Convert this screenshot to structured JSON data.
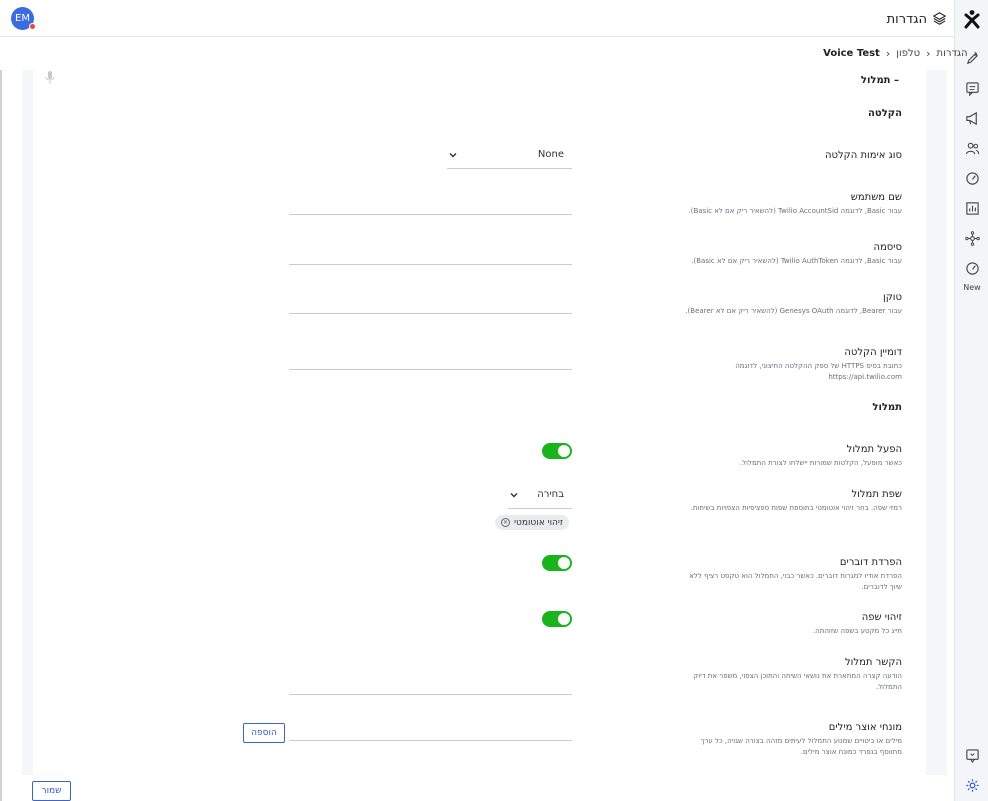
{
  "header": {
    "title": "הגדרות",
    "avatar_initials": "EM"
  },
  "breadcrumb": {
    "items": [
      "הגדרות",
      "טלפון",
      "Voice Test"
    ]
  },
  "rail": {
    "new_label": "New"
  },
  "section_toggle": "– תמלול",
  "recording": {
    "section_title": "הקלטה",
    "auth_type": {
      "label": "סוג אימות הקלטה",
      "value": "None"
    },
    "username": {
      "label": "שם משתמש",
      "hint": "עבור Basic, לדוגמה Twilio AccountSid (להשאיר ריק אם לא Basic)."
    },
    "password": {
      "label": "סיסמה",
      "hint": "עבור Basic, לדוגמה Twilio AuthToken (להשאיר ריק אם לא Basic)."
    },
    "token": {
      "label": "טוקן",
      "hint": "עבור Bearer, לדוגמה Genesys OAuth (להשאיר ריק אם לא Bearer)."
    },
    "domain": {
      "label": "דומיין הקלטה",
      "hint": "כתובת בסיס HTTPS של ספק ההקלטה החיצוני, לדוגמה https://api.twilio.com"
    }
  },
  "transcription": {
    "section_title": "תמלול",
    "enable": {
      "label": "הפעל תמלול",
      "hint": "כאשר מופעל, הקלטות שמורות יישלחו לצורת התמלול.",
      "on": true
    },
    "language": {
      "label": "שפת תמלול",
      "hint": "רמזי שפה. בחר זיהוי אוטומטי בתוספת שפות ספציפיות הצפויות בשיחות.",
      "select_value": "בחירה",
      "chip": "זיהוי אוטומטי"
    },
    "diarization": {
      "label": "הפרדת דוברים",
      "hint": "הפרדת אודיו למגרות דוברים. כאשר כבוי, התמלול הוא טקסט רציף ללא שיוך לדוברים.",
      "on": true
    },
    "language_detect": {
      "label": "זיהוי שפה",
      "hint": "תייג כל מקטע בשפה שזוהתה.",
      "on": true
    },
    "context": {
      "label": "הקשר תמלול",
      "hint": "הודעה קצרה המתארת את נושאי השיחה והתוכן הצפוי, משפר את דיוק התמלול."
    },
    "vocabulary": {
      "label": "מונחי אוצר מילים",
      "hint": "מילים או ביטויים שמנוע התמלול לעיתים מזהה בצורה שגויה, כל ערך מתווסף בנפרד כמונח אוצר מילים."
    }
  },
  "buttons": {
    "add": "הוספה",
    "save": "שמור"
  },
  "colors": {
    "accent": "#2e5cc4",
    "toggle_on": "#1ab31e",
    "avatar": "#3c6be0"
  },
  "icons": [
    "logo-icon",
    "layers-icon",
    "pencil-icon",
    "chat-icon",
    "megaphone-icon",
    "users-icon",
    "gauge-icon",
    "bar-chart-icon",
    "network-icon",
    "gauge-new-icon",
    "feedback-icon",
    "settings-icon",
    "microphone-icon"
  ]
}
